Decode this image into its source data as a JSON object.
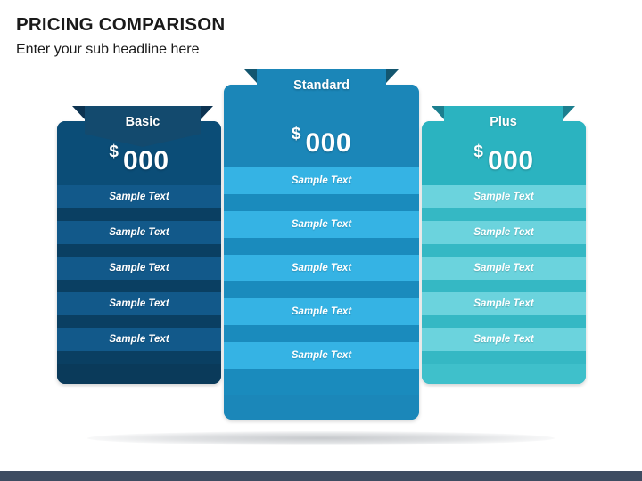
{
  "slide": {
    "title": "PRICING COMPARISON",
    "subtitle": "Enter your sub headline here",
    "background": "#ffffff",
    "bottom_bar_color": "#3e4c61"
  },
  "plans": [
    {
      "name": "Basic",
      "currency": "$",
      "amount": "000",
      "colors": {
        "header": "#0b4d77",
        "ribbon": "#134a6e",
        "ribbon_wing": "#0c3351",
        "row": "#12598a",
        "row_gap": "#0a3f62",
        "footer": "#0a3a5a"
      },
      "features": [
        "Sample Text",
        "Sample Text",
        "Sample Text",
        "Sample Text",
        "Sample Text"
      ]
    },
    {
      "name": "Standard",
      "currency": "$",
      "amount": "000",
      "colors": {
        "header": "#1b86b8",
        "ribbon": "#1b86b8",
        "ribbon_wing": "#13566f",
        "row": "#35b3e4",
        "row_gap": "#1a8bbd",
        "footer": "#1b87b9"
      },
      "features": [
        "Sample Text",
        "Sample Text",
        "Sample Text",
        "Sample Text",
        "Sample Text"
      ]
    },
    {
      "name": "Plus",
      "currency": "$",
      "amount": "000",
      "colors": {
        "header": "#2bb3c0",
        "ribbon": "#2bb3c0",
        "ribbon_wing": "#1c7f8f",
        "row": "#6bd3dd",
        "row_gap": "#35b8c4",
        "footer": "#3fc0cb"
      },
      "features": [
        "Sample Text",
        "Sample Text",
        "Sample Text",
        "Sample Text",
        "Sample Text"
      ]
    }
  ]
}
